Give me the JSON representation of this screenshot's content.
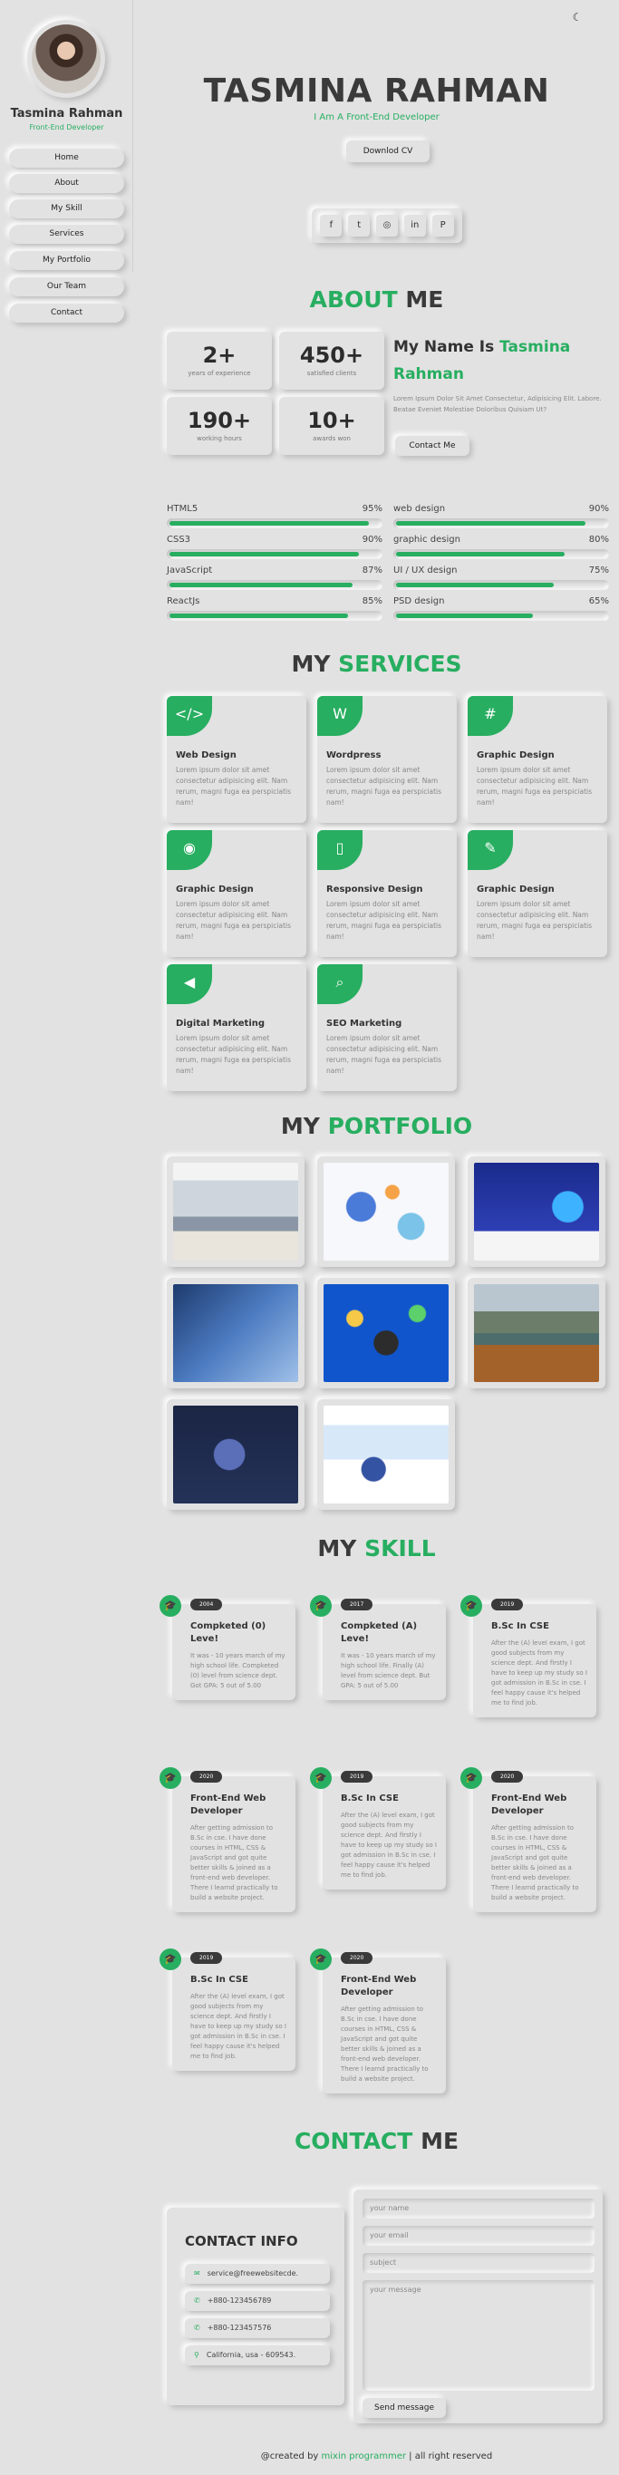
{
  "colors": {
    "accent": "#27ae60",
    "background": "#e2e2e2",
    "text": "#333333"
  },
  "sidebar": {
    "name": "Tasmina Rahman",
    "role": "Front-End Developer",
    "nav": [
      "Home",
      "About",
      "My Skill",
      "Services",
      "My Portfolio",
      "Our Team",
      "Contact"
    ]
  },
  "theme_toggle": {
    "icon": "moon-icon",
    "glyph": "☾"
  },
  "hero": {
    "name": "TASMINA RAHMAN",
    "role": "I Am A Front-End Developer",
    "cv_button": "Downlod CV",
    "social": [
      {
        "icon": "facebook-icon",
        "glyph": "f"
      },
      {
        "icon": "twitter-icon",
        "glyph": "t"
      },
      {
        "icon": "instagram-icon",
        "glyph": "◎"
      },
      {
        "icon": "linkedin-icon",
        "glyph": "in"
      },
      {
        "icon": "pinterest-icon",
        "glyph": "P"
      }
    ]
  },
  "about": {
    "title_a": "ABOUT",
    "title_b": "ME",
    "stats": [
      {
        "value": "2+",
        "label": "years of experience"
      },
      {
        "value": "450+",
        "label": "satisfied clients"
      },
      {
        "value": "190+",
        "label": "working hours"
      },
      {
        "value": "10+",
        "label": "awards won"
      }
    ],
    "heading_a": "My Name Is",
    "heading_b": "Tasmina Rahman",
    "text": "Lorem Ipsum Dolor Sit Amet Consectetur, Adipisicing Elit. Labore. Beatae Eveniet Molestiae Doloribus Quisiam Ut?",
    "contact_button": "Contact Me"
  },
  "skills": [
    {
      "name": "HTML5",
      "percent": "95%",
      "value": 95
    },
    {
      "name": "web design",
      "percent": "90%",
      "value": 90
    },
    {
      "name": "CSS3",
      "percent": "90%",
      "value": 90
    },
    {
      "name": "graphic design",
      "percent": "80%",
      "value": 80
    },
    {
      "name": "JavaScript",
      "percent": "87%",
      "value": 87
    },
    {
      "name": "UI / UX design",
      "percent": "75%",
      "value": 75
    },
    {
      "name": "ReactJs",
      "percent": "85%",
      "value": 85
    },
    {
      "name": "PSD design",
      "percent": "65%",
      "value": 65
    }
  ],
  "services": {
    "title_a": "MY",
    "title_b": "SERVICES",
    "items": [
      {
        "title": "Web Design",
        "icon": "code-icon",
        "glyph": "</>",
        "text": "Lorem ipsum dolor sit amet consectetur adipisicing elit. Nam rerum, magni fuga ea perspiciatis nam!"
      },
      {
        "title": "Wordpress",
        "icon": "wordpress-icon",
        "glyph": "W",
        "text": "Lorem ipsum dolor sit amet consectetur adipisicing elit. Nam rerum, magni fuga ea perspiciatis nam!"
      },
      {
        "title": "Graphic Design",
        "icon": "slack-icon",
        "glyph": "#",
        "text": "Lorem ipsum dolor sit amet consectetur adipisicing elit. Nam rerum, magni fuga ea perspiciatis nam!"
      },
      {
        "title": "Graphic Design",
        "icon": "github-icon",
        "glyph": "◉",
        "text": "Lorem ipsum dolor sit amet consectetur adipisicing elit. Nam rerum, magni fuga ea perspiciatis nam!"
      },
      {
        "title": "Responsive Design",
        "icon": "mobile-icon",
        "glyph": "▯",
        "text": "Lorem ipsum dolor sit amet consectetur adipisicing elit. Nam rerum, magni fuga ea perspiciatis nam!"
      },
      {
        "title": "Graphic Design",
        "icon": "paint-brush-icon",
        "glyph": "✎",
        "text": "Lorem ipsum dolor sit amet consectetur adipisicing elit. Nam rerum, magni fuga ea perspiciatis nam!"
      },
      {
        "title": "Digital Marketing",
        "icon": "bullhorn-icon",
        "glyph": "◀",
        "text": "Lorem ipsum dolor sit amet consectetur adipisicing elit. Nam rerum, magni fuga ea perspiciatis nam!"
      },
      {
        "title": "SEO Marketing",
        "icon": "search-dollar-icon",
        "glyph": "⌕",
        "text": "Lorem ipsum dolor sit amet consectetur adipisicing elit. Nam rerum, magni fuga ea perspiciatis nam!"
      }
    ]
  },
  "portfolio": {
    "title_a": "MY",
    "title_b": "PORTFOLIO",
    "items": [
      {
        "name": "portfolio-image-meeting"
      },
      {
        "name": "portfolio-image-analytics-illustration"
      },
      {
        "name": "portfolio-image-dashboard-illustration"
      },
      {
        "name": "portfolio-image-laptop-hand"
      },
      {
        "name": "portfolio-image-developer-illustration"
      },
      {
        "name": "portfolio-image-lake-boat"
      },
      {
        "name": "portfolio-image-programming-dark"
      },
      {
        "name": "portfolio-image-screen-illustration"
      }
    ]
  },
  "timeline": {
    "title_a": "MY",
    "title_b": "SKILL",
    "items": [
      {
        "year": "2004",
        "title": "Compketed (0) Leve!",
        "text": "It was - 10 years march of my high school life. Compketed (0) level from science dept. Got GPA: 5 out of 5.00"
      },
      {
        "year": "2017",
        "title": "Compketed (A) Leve!",
        "text": "It was - 10 years march of my high school life. Finally (A) level from science dept. But GPA: 5 out of 5.00"
      },
      {
        "year": "2019",
        "title": "B.Sc In CSE",
        "text": "After the (A) level exam, I got good subjects from my science dept. And firstly I have to keep up my study so I got admission in B.Sc in cse. I feel happy cause it's helped me to find job."
      },
      {
        "year": "2020",
        "title": "Front-End Web Developer",
        "text": "After getting admission to B.Sc in cse. I have done courses in HTML, CSS & JavaScript and got quite better skills & joined as a front-end web developer. There I learnd practically to build a website project."
      },
      {
        "year": "2019",
        "title": "B.Sc In CSE",
        "text": "After the (A) level exam, I got good subjects from my science dept. And firstly I have to keep up my study so I got admission in B.Sc in cse. I feel happy cause it's helped me to find job."
      },
      {
        "year": "2020",
        "title": "Front-End Web Developer",
        "text": "After getting admission to B.Sc in cse. I have done courses in HTML, CSS & JavaScript and got quite better skills & joined as a front-end web developer. There I learnd practically to build a website project."
      },
      {
        "year": "2019",
        "title": "B.Sc In CSE",
        "text": "After the (A) level exam, I got good subjects from my science dept. And firstly I have to keep up my study so I got admission in B.Sc in cse. I feel happy cause it's helped me to find job."
      },
      {
        "year": "2020",
        "title": "Front-End Web Developer",
        "text": "After getting admission to B.Sc in cse. I have done courses in HTML, CSS & JavaScript and got quite better skills & joined as a front-end web developer. There I learnd practically to build a website project."
      }
    ]
  },
  "contact": {
    "title_a": "CONTACT",
    "title_b": "ME",
    "info_title": "CONTACT INFO",
    "info": [
      {
        "icon": "envelope-icon",
        "glyph": "✉",
        "text": "service@freewebsitecde."
      },
      {
        "icon": "phone-icon",
        "glyph": "✆",
        "text": "+880-123456789"
      },
      {
        "icon": "phone-icon",
        "glyph": "✆",
        "text": "+880-123457576"
      },
      {
        "icon": "location-icon",
        "glyph": "⚲",
        "text": "California, usa - 609543."
      }
    ],
    "form": {
      "name_placeholder": "your name",
      "email_placeholder": "your email",
      "subject_placeholder": "subject",
      "message_placeholder": "your message",
      "send_button": "Send message"
    }
  },
  "footer": {
    "prefix": "@created by",
    "author": "mixin programmer",
    "suffix": "| all right reserved"
  }
}
